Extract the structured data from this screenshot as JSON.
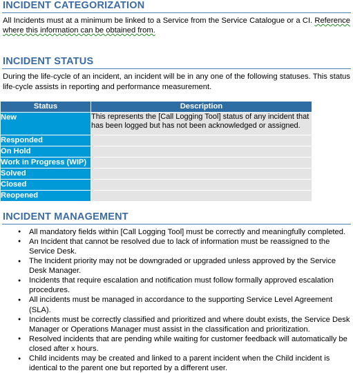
{
  "document": {
    "sections": [
      {
        "id": "incident-categorization",
        "heading": "INCIDENT CATEGORIZATION",
        "paragraph_part_1": "All Incidents must at a minimum be linked to a Service from the Service Catalogue or a CI. ",
        "paragraph_part_2": "Reference where this information can be obtained from."
      },
      {
        "id": "incident-status",
        "heading": "INCIDENT STATUS",
        "paragraph": "During the life-cycle of an incident, an incident will be in any one of the following statuses.  This status life-cycle assists in reporting and performance measurement."
      },
      {
        "id": "incident-management",
        "heading": "INCIDENT MANAGEMENT"
      }
    ]
  },
  "status_table": {
    "columns": [
      "Status",
      "Description"
    ],
    "rows": [
      {
        "status": "New",
        "description": "This represents the [Call Logging Tool] status of any incident that has been logged but has not been acknowledged or assigned."
      },
      {
        "status": "Responded",
        "description": ""
      },
      {
        "status": "On Hold",
        "description": ""
      },
      {
        "status": "Work in Progress (WIP)",
        "description": ""
      },
      {
        "status": "Solved",
        "description": ""
      },
      {
        "status": "Closed",
        "description": ""
      },
      {
        "status": "Reopened",
        "description": ""
      }
    ]
  },
  "management_bullets": [
    "All mandatory fields within [Call Logging Tool] must be correctly and meaningfully completed.",
    "An Incident that cannot be resolved due to lack of information must be reassigned to the Service Desk.",
    "The Incident priority may not be downgraded or upgraded unless approved by the Service Desk Manager.",
    "Incidents that require escalation and notification must follow formally approved escalation procedures.",
    "All incidents must be managed in accordance to the supporting Service Level Agreement (SLA).",
    "Incidents must be correctly classified and prioritized and where doubt exists, the Service Desk Manager or Operations Manager must assist in the classification and prioritization.",
    "Resolved incidents that are pending while waiting for customer feedback will automatically be closed after x hours.",
    "Child incidents may be created and linked to a parent incident when the Child incident is identical to the parent one but reported by a different user."
  ],
  "colors": {
    "heading_blue": "#3a6ba5",
    "rule_blue": "#4a7ebb",
    "table_header_blue": "#2e6da4",
    "status_cell_blue": "#009ad8",
    "description_cell_gray": "#e4e4e4",
    "grammar_squiggle_green": "#1f8a1f",
    "body_text": "#000000"
  }
}
